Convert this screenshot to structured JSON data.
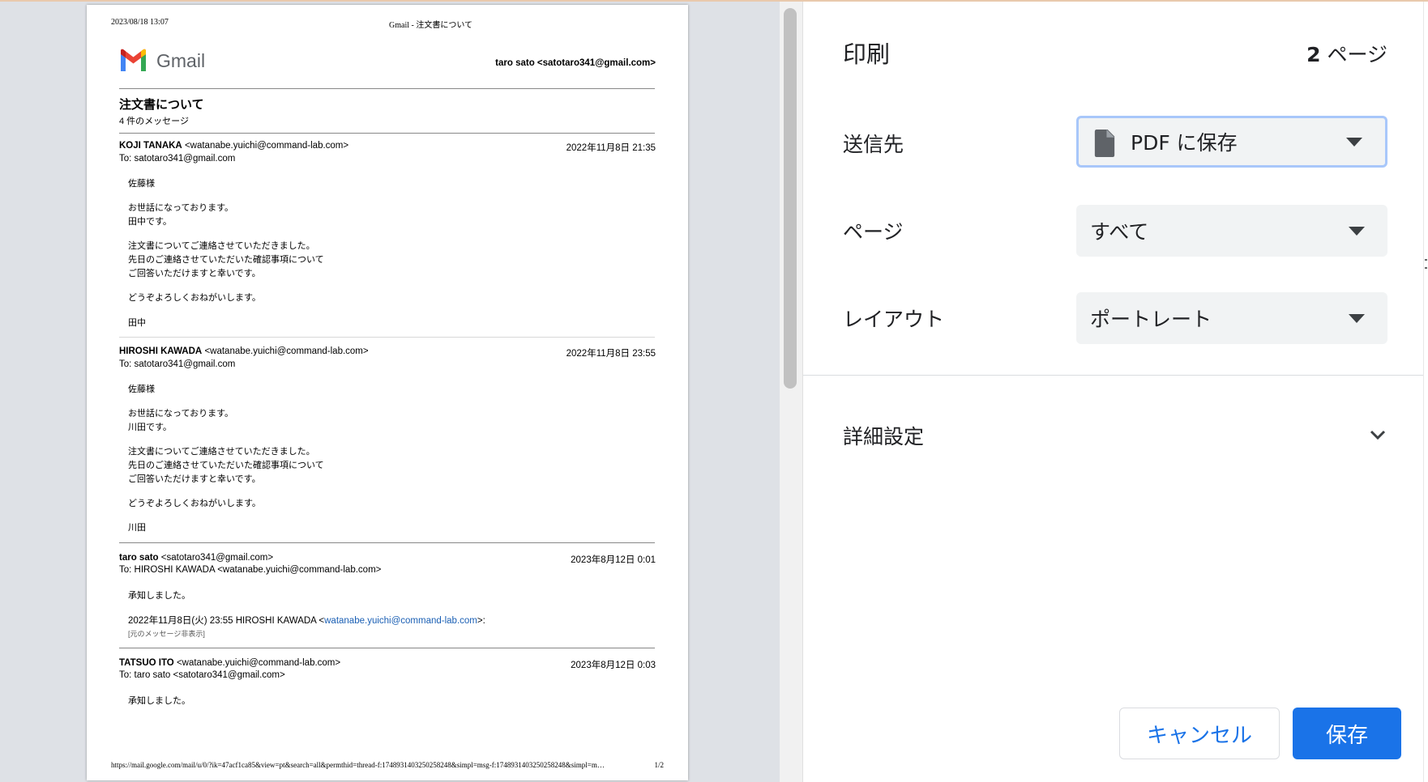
{
  "colors": {
    "accent": "#1a73e8",
    "preview_background": "#dee1e6",
    "link": "#1a5fb4",
    "focus_ring": "#a8c7fa"
  },
  "preview": {
    "page_header": {
      "date": "2023/08/18 13:07",
      "title": "Gmail - 注文書について"
    },
    "logo_text": "Gmail",
    "account": "taro sato <satotaro341@gmail.com>",
    "thread_subject": "注文書について",
    "message_count": "4 件のメッセージ",
    "messages": [
      {
        "sender_name": "KOJI TANAKA",
        "sender_email": "<watanabe.yuichi@command-lab.com>",
        "date": "2022年11月8日 21:35",
        "to": "To: satotaro341@gmail.com",
        "body": [
          "佐藤様",
          "お世話になっております。",
          "田中です。",
          "注文書についてご連絡させていただきました。",
          "先日のご連絡させていただいた確認事項について",
          "ご回答いただけますと幸いです。",
          "どうぞよろしくおねがいします。",
          "田中"
        ]
      },
      {
        "sender_name": "HIROSHI KAWADA",
        "sender_email": "<watanabe.yuichi@command-lab.com>",
        "date": "2022年11月8日 23:55",
        "to": "To: satotaro341@gmail.com",
        "body": [
          "佐藤様",
          "お世話になっております。",
          "川田です。",
          "注文書についてご連絡させていただきました。",
          "先日のご連絡させていただいた確認事項について",
          "ご回答いただけますと幸いです。",
          "どうぞよろしくおねがいします。",
          "川田"
        ]
      },
      {
        "sender_name": "taro sato",
        "sender_email": "<satotaro341@gmail.com>",
        "date": "2023年8月12日 0:01",
        "to": "To: HIROSHI KAWADA <watanabe.yuichi@command-lab.com>",
        "body": [
          "承知しました。"
        ],
        "quote_prefix": "2022年11月8日(火) 23:55 HIROSHI KAWADA <",
        "quote_link": "watanabe.yuichi@command-lab.com",
        "quote_suffix": ">:",
        "hidden_note": "[元のメッセージ非表示]"
      },
      {
        "sender_name": "TATSUO ITO",
        "sender_email": "<watanabe.yuichi@command-lab.com>",
        "date": "2023年8月12日 0:03",
        "to": "To: taro sato <satotaro341@gmail.com>",
        "body": [
          "承知しました。"
        ]
      }
    ],
    "footer_url": "https://mail.google.com/mail/u/0/?ik=47acf1ca85&view=pt&search=all&permthid=thread-f:1748931403250258248&simpl=msg-f:1748931403250258248&simpl=m…",
    "footer_page": "1/2"
  },
  "panel": {
    "title": "印刷",
    "page_count": "2 ページ",
    "destination": {
      "label": "送信先",
      "value": "PDF に保存",
      "icon": "document-icon"
    },
    "pages": {
      "label": "ページ",
      "value": "すべて"
    },
    "layout": {
      "label": "レイアウト",
      "value": "ポートレート"
    },
    "more_settings": {
      "label": "詳細設定",
      "icon": "chevron-down-icon"
    },
    "cancel_label": "キャンセル",
    "save_label": "保存"
  }
}
